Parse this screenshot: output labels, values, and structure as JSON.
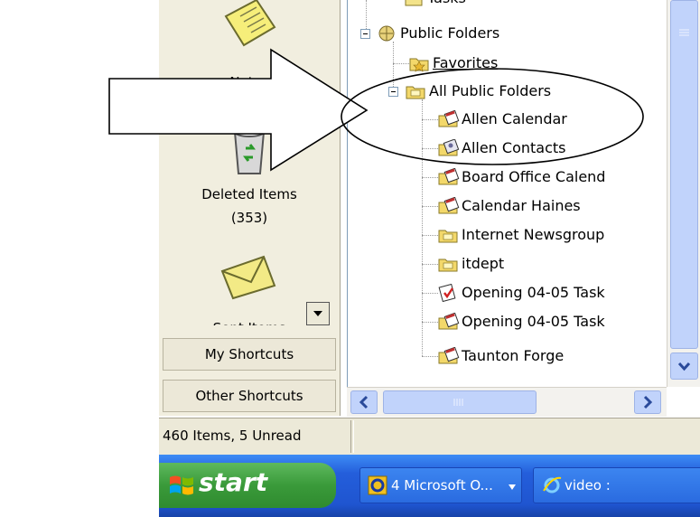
{
  "outlook_bar": {
    "partial_top_label": "Notes",
    "deleted_items_label": "Deleted Items",
    "deleted_items_count": "(353)",
    "partial_bottom_label": "Sent Items",
    "my_shortcuts_label": "My Shortcuts",
    "other_shortcuts_label": "Other Shortcuts"
  },
  "folder_tree": {
    "cropped_top_label": "Tasks",
    "public_folders_label": "Public Folders",
    "favorites_label": "Favorites",
    "all_public_folders_label": "All Public Folders",
    "items": [
      {
        "label": "Allen Calendar",
        "icon": "calendar-folder-icon"
      },
      {
        "label": "Allen Contacts",
        "icon": "contacts-folder-icon"
      },
      {
        "label": "Board Office Calend",
        "icon": "calendar-folder-icon"
      },
      {
        "label": "Calendar Haines",
        "icon": "calendar-folder-icon"
      },
      {
        "label": "Internet Newsgroup",
        "icon": "mail-folder-icon"
      },
      {
        "label": "itdept",
        "icon": "mail-folder-icon"
      },
      {
        "label": "Opening 04-05 Task",
        "icon": "tasks-folder-icon"
      },
      {
        "label": "Opening 04-05 Task",
        "icon": "calendar-folder-icon"
      },
      {
        "label": "Taunton Forge",
        "icon": "calendar-folder-icon"
      }
    ]
  },
  "status_bar": {
    "text": "460 Items, 5 Unread"
  },
  "taskbar": {
    "start_label": "start",
    "task1_label": "4 Microsoft O...",
    "task2_label": "video :"
  },
  "colors": {
    "outlook_bar_bg": "#f1eedf",
    "taskbar_blue": "#245edb",
    "start_green": "#3a9a3a",
    "scrollbar_blue": "#c1d3fb"
  }
}
